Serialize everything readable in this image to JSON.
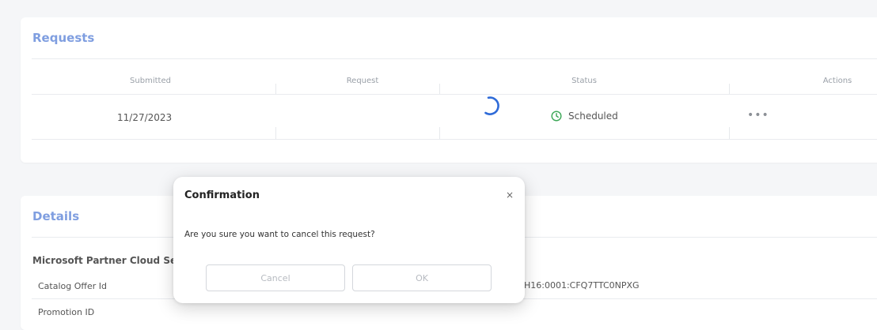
{
  "requests": {
    "title": "Requests",
    "columns": {
      "submitted": "Submitted",
      "request": "Request",
      "status": "Status",
      "actions": "Actions"
    },
    "rows": [
      {
        "submitted": "11/27/2023",
        "request": "",
        "status": "Scheduled",
        "status_icon": "clock-icon",
        "actions_icon": "more-dots-icon",
        "actions": "•••"
      }
    ]
  },
  "details": {
    "title": "Details",
    "section_heading": "Microsoft Partner Cloud Se",
    "fields": [
      {
        "key": "Catalog Offer Id",
        "value": "H16:0001:CFQ7TTC0NPXG"
      },
      {
        "key": "Promotion ID",
        "value": ""
      }
    ]
  },
  "dialog": {
    "title": "Confirmation",
    "close_symbol": "×",
    "message": "Are you sure you want to cancel this request?",
    "cancel_label": "Cancel",
    "ok_label": "OK"
  },
  "colors": {
    "title_accent": "#7f9ee0",
    "spinner": "#2f6bd8",
    "status_ok": "#3aa655"
  }
}
